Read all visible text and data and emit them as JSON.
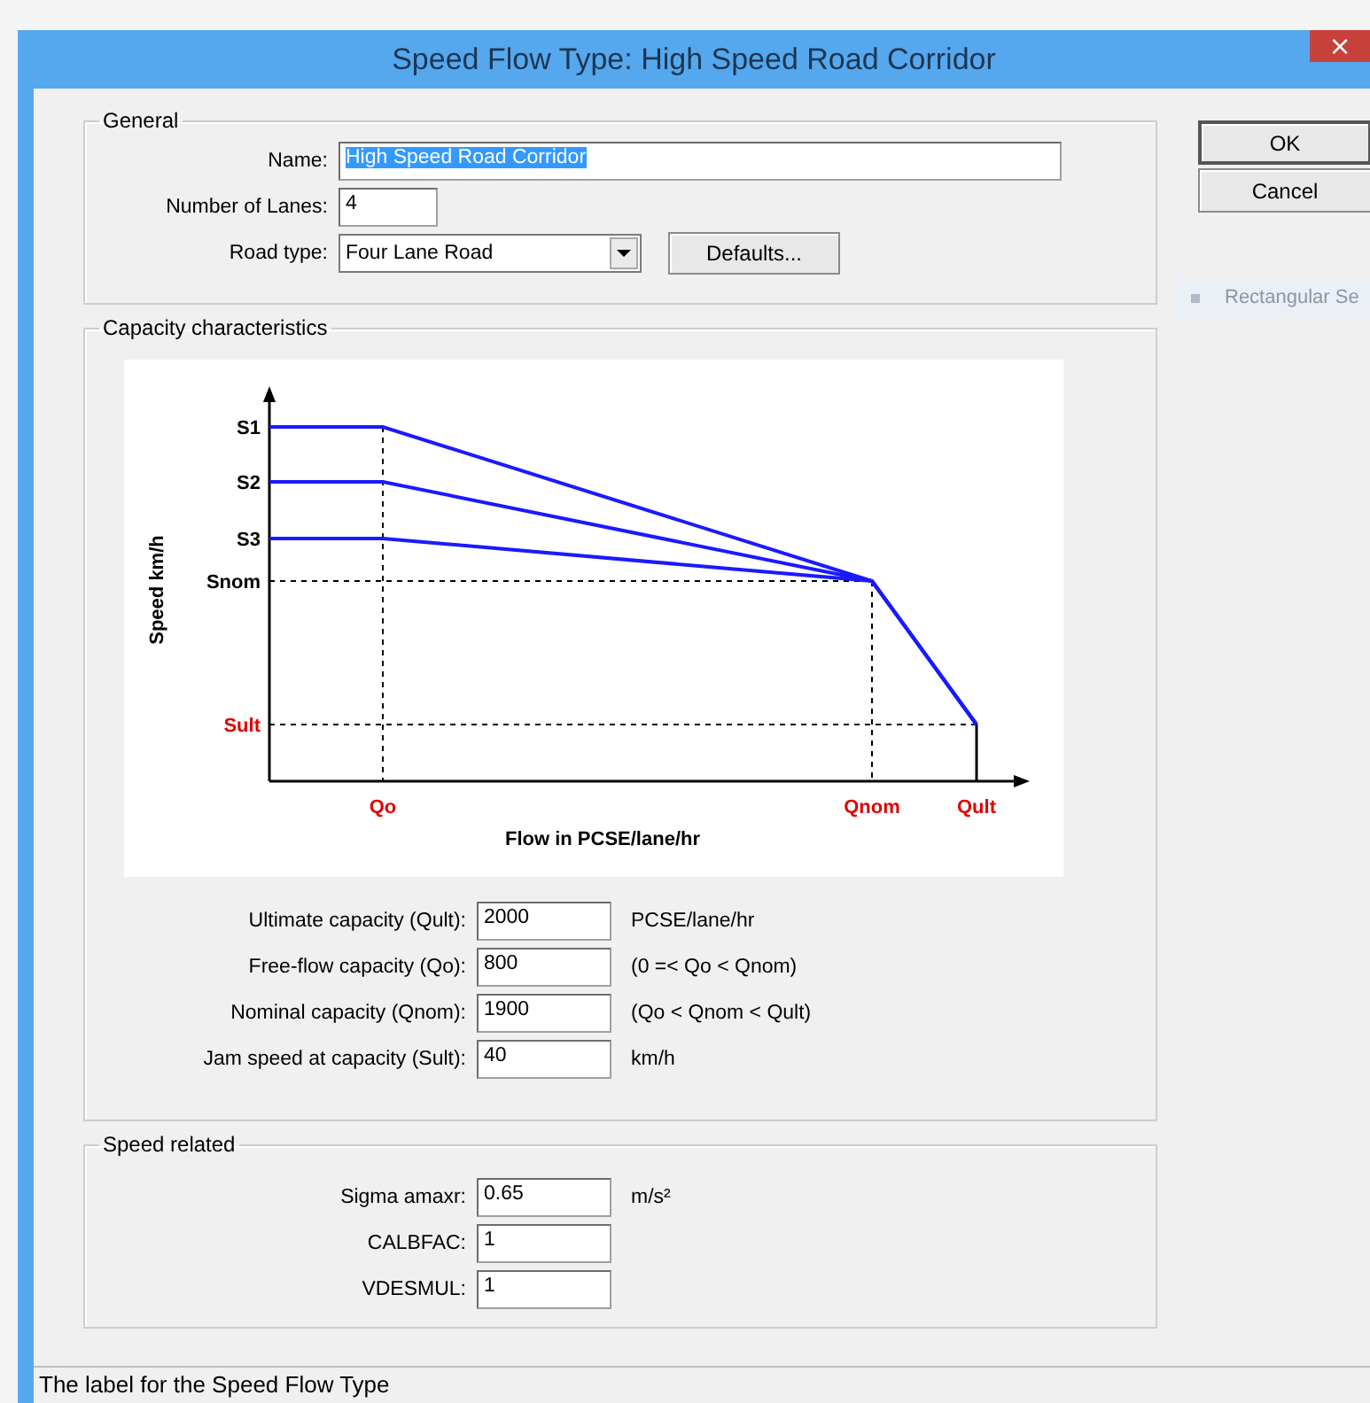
{
  "window": {
    "title": "Speed Flow Type: High Speed Road Corridor",
    "close": "×"
  },
  "general": {
    "legend": "General",
    "name": {
      "label": "Name:",
      "value": "High Speed Road Corridor",
      "text_selected": true
    },
    "lanes": {
      "label": "Number of Lanes:",
      "value": "4"
    },
    "road_type": {
      "label": "Road type:",
      "value": "Four Lane Road"
    },
    "defaults_button": "Defaults..."
  },
  "buttons": [
    "OK",
    "Cancel"
  ],
  "background_hint": "Rectangular Se",
  "capacity": {
    "legend": "Capacity characteristics",
    "diagram": {
      "y_axis_title": "Speed km/h",
      "x_axis_title": "Flow in PCSE/lane/hr",
      "speed_labels": [
        {
          "text": "S1",
          "color": "#000000"
        },
        {
          "text": "S2",
          "color": "#000000"
        },
        {
          "text": "S3",
          "color": "#000000"
        },
        {
          "text": "Snom",
          "color": "#000000"
        },
        {
          "text": "Sult",
          "color": "#e00000"
        }
      ],
      "flow_labels": [
        {
          "text": "Qo",
          "color": "#e00000"
        },
        {
          "text": "Qnom",
          "color": "#e00000"
        },
        {
          "text": "Qult",
          "color": "#e00000"
        }
      ]
    },
    "fields": [
      {
        "label": "Ultimate capacity (Qult):",
        "value": "2000",
        "unit": "PCSE/lane/hr"
      },
      {
        "label": "Free-flow capacity (Qo):",
        "value": "800",
        "unit": "(0 =< Qo < Qnom)"
      },
      {
        "label": "Nominal capacity (Qnom):",
        "value": "1900",
        "unit": "(Qo < Qnom < Qult)"
      },
      {
        "label": "Jam speed at capacity (Sult):",
        "value": "40",
        "unit": "km/h"
      }
    ]
  },
  "speed_related": {
    "legend": "Speed related",
    "fields": [
      {
        "label": "Sigma amaxr:",
        "value": "0.65",
        "unit": "m/s²"
      },
      {
        "label": "CALBFAC:",
        "value": "1"
      },
      {
        "label": "VDESMUL:",
        "value": "1"
      }
    ]
  },
  "status_bar": "The label for the Speed Flow Type"
}
